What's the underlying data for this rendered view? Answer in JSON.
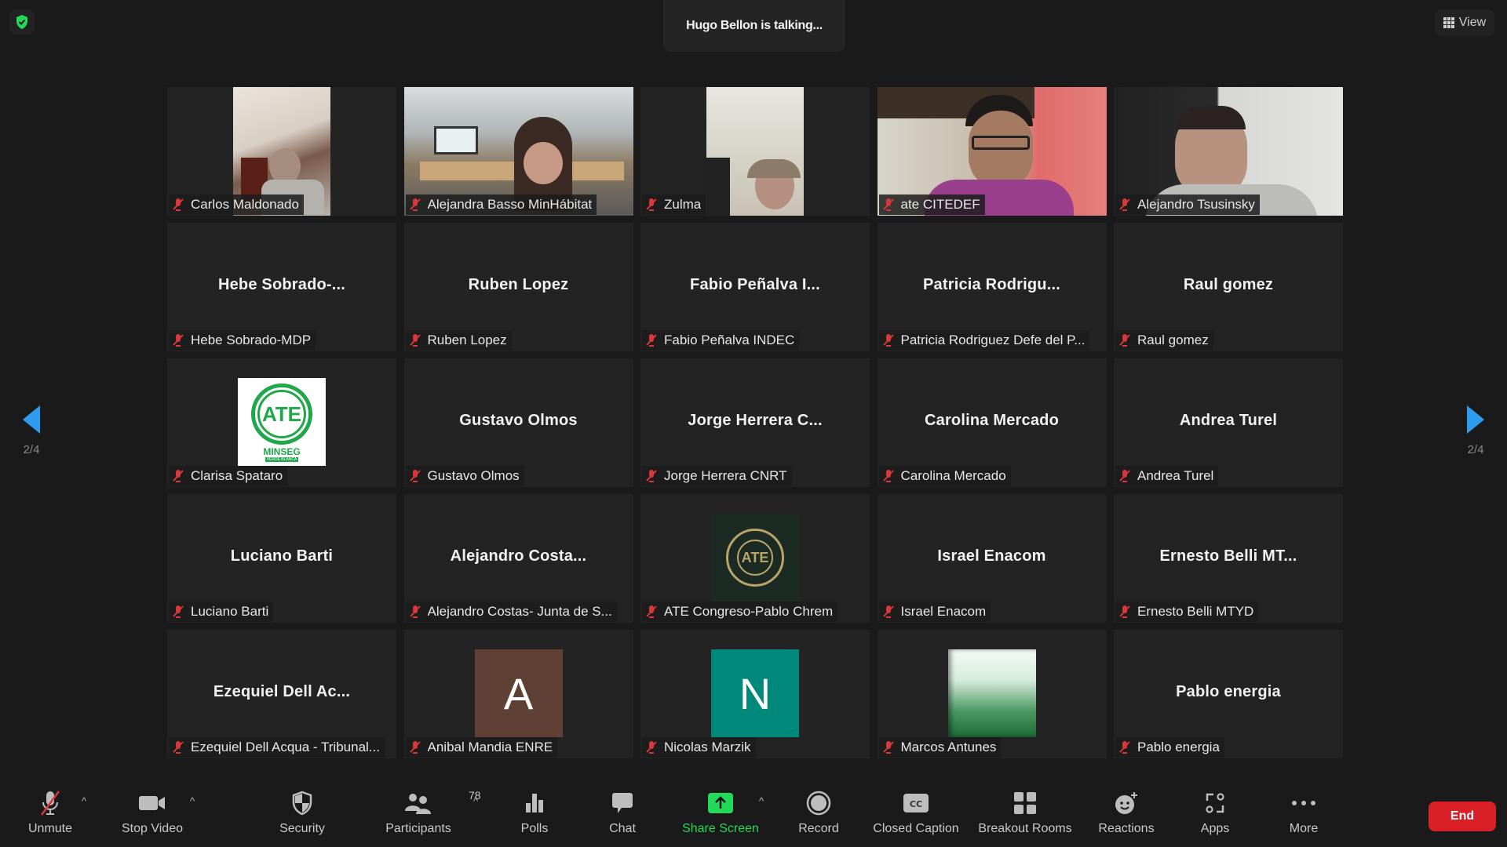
{
  "meeting": {
    "talking_banner": "Hugo Bellon is talking...",
    "view_label": "View",
    "page_indicator": "2/4",
    "security_badge_color": "#23d959"
  },
  "participants": [
    {
      "tile_name": "",
      "label": "Carlos Maldonado",
      "type": "video",
      "muted": true
    },
    {
      "tile_name": "",
      "label": "Alejandra Basso MinHábitat",
      "type": "video",
      "muted": true
    },
    {
      "tile_name": "",
      "label": "Zulma",
      "type": "video",
      "muted": true
    },
    {
      "tile_name": "",
      "label": "ate CITEDEF",
      "type": "video",
      "muted": true
    },
    {
      "tile_name": "",
      "label": "Alejandro Tsusinsky",
      "type": "video",
      "muted": true
    },
    {
      "tile_name": "Hebe  Sobrado-...",
      "label": "Hebe Sobrado-MDP",
      "type": "name",
      "muted": true
    },
    {
      "tile_name": "Ruben Lopez",
      "label": "Ruben Lopez",
      "type": "name",
      "muted": true
    },
    {
      "tile_name": "Fabio  Peñalva  I...",
      "label": "Fabio Peñalva INDEC",
      "type": "name",
      "muted": true
    },
    {
      "tile_name": "Patricia  Rodrigu...",
      "label": "Patricia Rodriguez Defe del P...",
      "type": "name",
      "muted": true
    },
    {
      "tile_name": "Raul gomez",
      "label": "Raul gomez",
      "type": "name",
      "muted": true
    },
    {
      "tile_name": "",
      "label": "Clarisa Spataro",
      "type": "logo-ate-minseg",
      "logo_text": "ATE",
      "logo_sub": "MINSEG",
      "logo_sub2": "VERDE BLANCA",
      "muted": true
    },
    {
      "tile_name": "Gustavo Olmos",
      "label": "Gustavo Olmos",
      "type": "name",
      "muted": true
    },
    {
      "tile_name": "Jorge  Herrera  C...",
      "label": "Jorge Herrera CNRT",
      "type": "name",
      "muted": true
    },
    {
      "tile_name": "Carolina Mercado",
      "label": "Carolina Mercado",
      "type": "name",
      "muted": true
    },
    {
      "tile_name": "Andrea Turel",
      "label": "Andrea Turel",
      "type": "name",
      "muted": true
    },
    {
      "tile_name": "Luciano Barti",
      "label": "Luciano Barti",
      "type": "name",
      "muted": true
    },
    {
      "tile_name": "Alejandro  Costa...",
      "label": "Alejandro Costas- Junta de S...",
      "type": "name",
      "muted": true
    },
    {
      "tile_name": "",
      "label": "ATE Congreso-Pablo Chrem",
      "type": "logo-ate-card",
      "logo_text": "ATE",
      "muted": true
    },
    {
      "tile_name": "Israel Enacom",
      "label": "Israel Enacom",
      "type": "name",
      "muted": true
    },
    {
      "tile_name": "Ernesto  Belli  MT...",
      "label": "Ernesto Belli MTYD",
      "type": "name",
      "muted": true
    },
    {
      "tile_name": "Ezequiel  Dell  Ac...",
      "label": "Ezequiel Dell Acqua - Tribunal...",
      "type": "name",
      "muted": true
    },
    {
      "tile_name": "",
      "label": "Anibal Mandia ENRE",
      "type": "avatar",
      "initial": "A",
      "avatar_color": "#5e4034",
      "muted": true
    },
    {
      "tile_name": "",
      "label": "Nicolas Marzik",
      "type": "avatar",
      "initial": "N",
      "avatar_color": "#00897a",
      "muted": true
    },
    {
      "tile_name": "",
      "label": "Marcos Antunes",
      "type": "picture-green",
      "muted": true
    },
    {
      "tile_name": "Pablo energia",
      "label": "Pablo energia",
      "type": "name",
      "muted": true
    }
  ],
  "toolbar": {
    "unmute": "Unmute",
    "stop_video": "Stop Video",
    "security": "Security",
    "participants": "Participants",
    "participants_count": "78",
    "polls": "Polls",
    "chat": "Chat",
    "share_screen": "Share Screen",
    "record": "Record",
    "closed_caption": "Closed Caption",
    "breakout_rooms": "Breakout Rooms",
    "reactions": "Reactions",
    "apps": "Apps",
    "more": "More",
    "end": "End"
  }
}
